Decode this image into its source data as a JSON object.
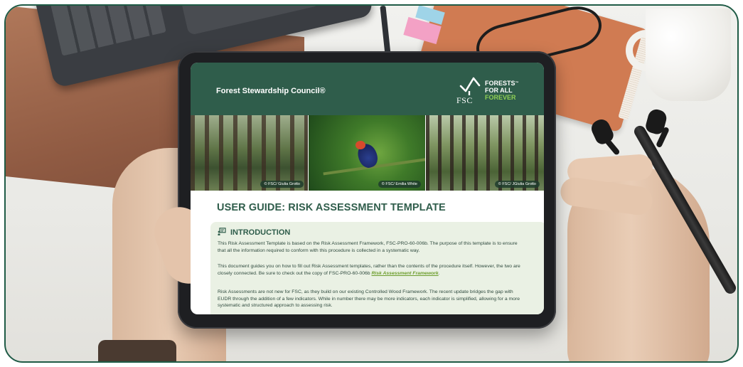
{
  "tablet_screen": {
    "header": {
      "org_name": "Forest Stewardship Council®",
      "logo": {
        "letters": "FSC",
        "tagline": [
          "FORESTS",
          "FOR ALL",
          "FOREVER"
        ],
        "tm": "™",
        "tree_icon": "fsc-tree-checkmark-icon",
        "colors": {
          "banner": "#2f5d4b",
          "forever": "#8fcf54"
        }
      }
    },
    "photos": [
      {
        "credit": "© FSC/ Giulia Grotto"
      },
      {
        "credit": "© FSC/ Emilia White"
      },
      {
        "credit": "© FSC/ JGiulia Grotto"
      }
    ],
    "title": "USER GUIDE: RISK ASSESSMENT TEMPLATE",
    "intro": {
      "heading": "INTRODUCTION",
      "icon": "presentation-board-icon",
      "paragraphs": [
        "This Risk Assessment Template is based on the Risk Assessment Framework, FSC-PRO-60-006b. The purpose of this template is to ensure that all the information required to conform with this procedure is collected in a systematic way.",
        "This document guides you on how to fill out Risk Assessment templates, rather than the contents of the procedure itself. However, the two are closely connected. Be sure to check out the copy of FSC-PRO-60-006b",
        "Risk Assessments are not new for FSC, as they build on our existing Controlled Wood Framework. The recent update bridges the gap with EUDR through the addition of a few indicators. While in number there may be more indicators, each indicator is simplified, allowing for a more systematic and structured approach to assessing risk."
      ],
      "link_text": "Risk Assessment Framework",
      "link_suffix": "."
    }
  }
}
